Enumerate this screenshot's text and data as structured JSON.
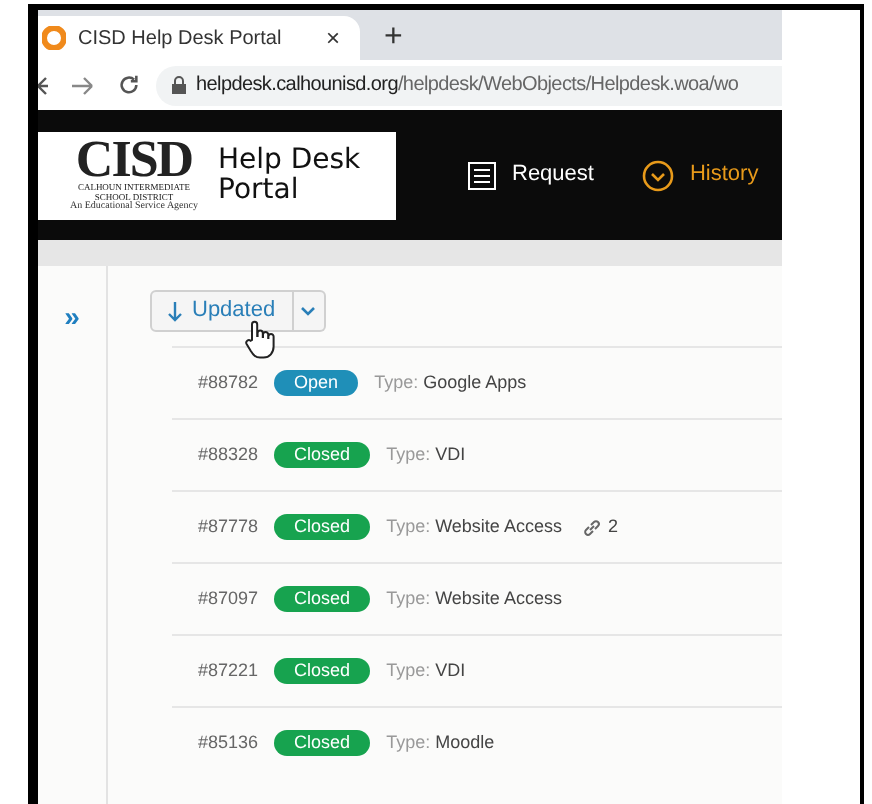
{
  "browser": {
    "tab_title": "CISD Help Desk Portal",
    "tab_close": "×",
    "new_tab": "+",
    "url_host": "helpdesk.calhounisd.org",
    "url_path": "/helpdesk/WebObjects/Helpdesk.woa/wo"
  },
  "header": {
    "logo": {
      "letters": "CISD",
      "tagline": "CALHOUN INTERMEDIATE SCHOOL DISTRICT",
      "subtitle": "An Educational Service Agency",
      "title": "Help Desk Portal"
    },
    "nav": [
      {
        "label": "Request",
        "kind": "list",
        "selected": false
      },
      {
        "label": "History",
        "kind": "chevron",
        "selected": true
      }
    ]
  },
  "sidebar": {
    "toggle": "»"
  },
  "sort": {
    "label": "Updated"
  },
  "tickets": [
    {
      "number": "#88782",
      "status": "Open",
      "color": "#1f8fb8",
      "type_label": "Type:",
      "type": "Google Apps"
    },
    {
      "number": "#88328",
      "status": "Closed",
      "color": "#17a34f",
      "type_label": "Type:",
      "type": "VDI"
    },
    {
      "number": "#87778",
      "status": "Closed",
      "color": "#17a34f",
      "type_label": "Type:",
      "type": "Website Access",
      "attachments": "2"
    },
    {
      "number": "#87097",
      "status": "Closed",
      "color": "#17a34f",
      "type_label": "Type:",
      "type": "Website Access"
    },
    {
      "number": "#87221",
      "status": "Closed",
      "color": "#17a34f",
      "type_label": "Type:",
      "type": "VDI"
    },
    {
      "number": "#85136",
      "status": "Closed",
      "color": "#17a34f",
      "type_label": "Type:",
      "type": "Moodle"
    }
  ]
}
